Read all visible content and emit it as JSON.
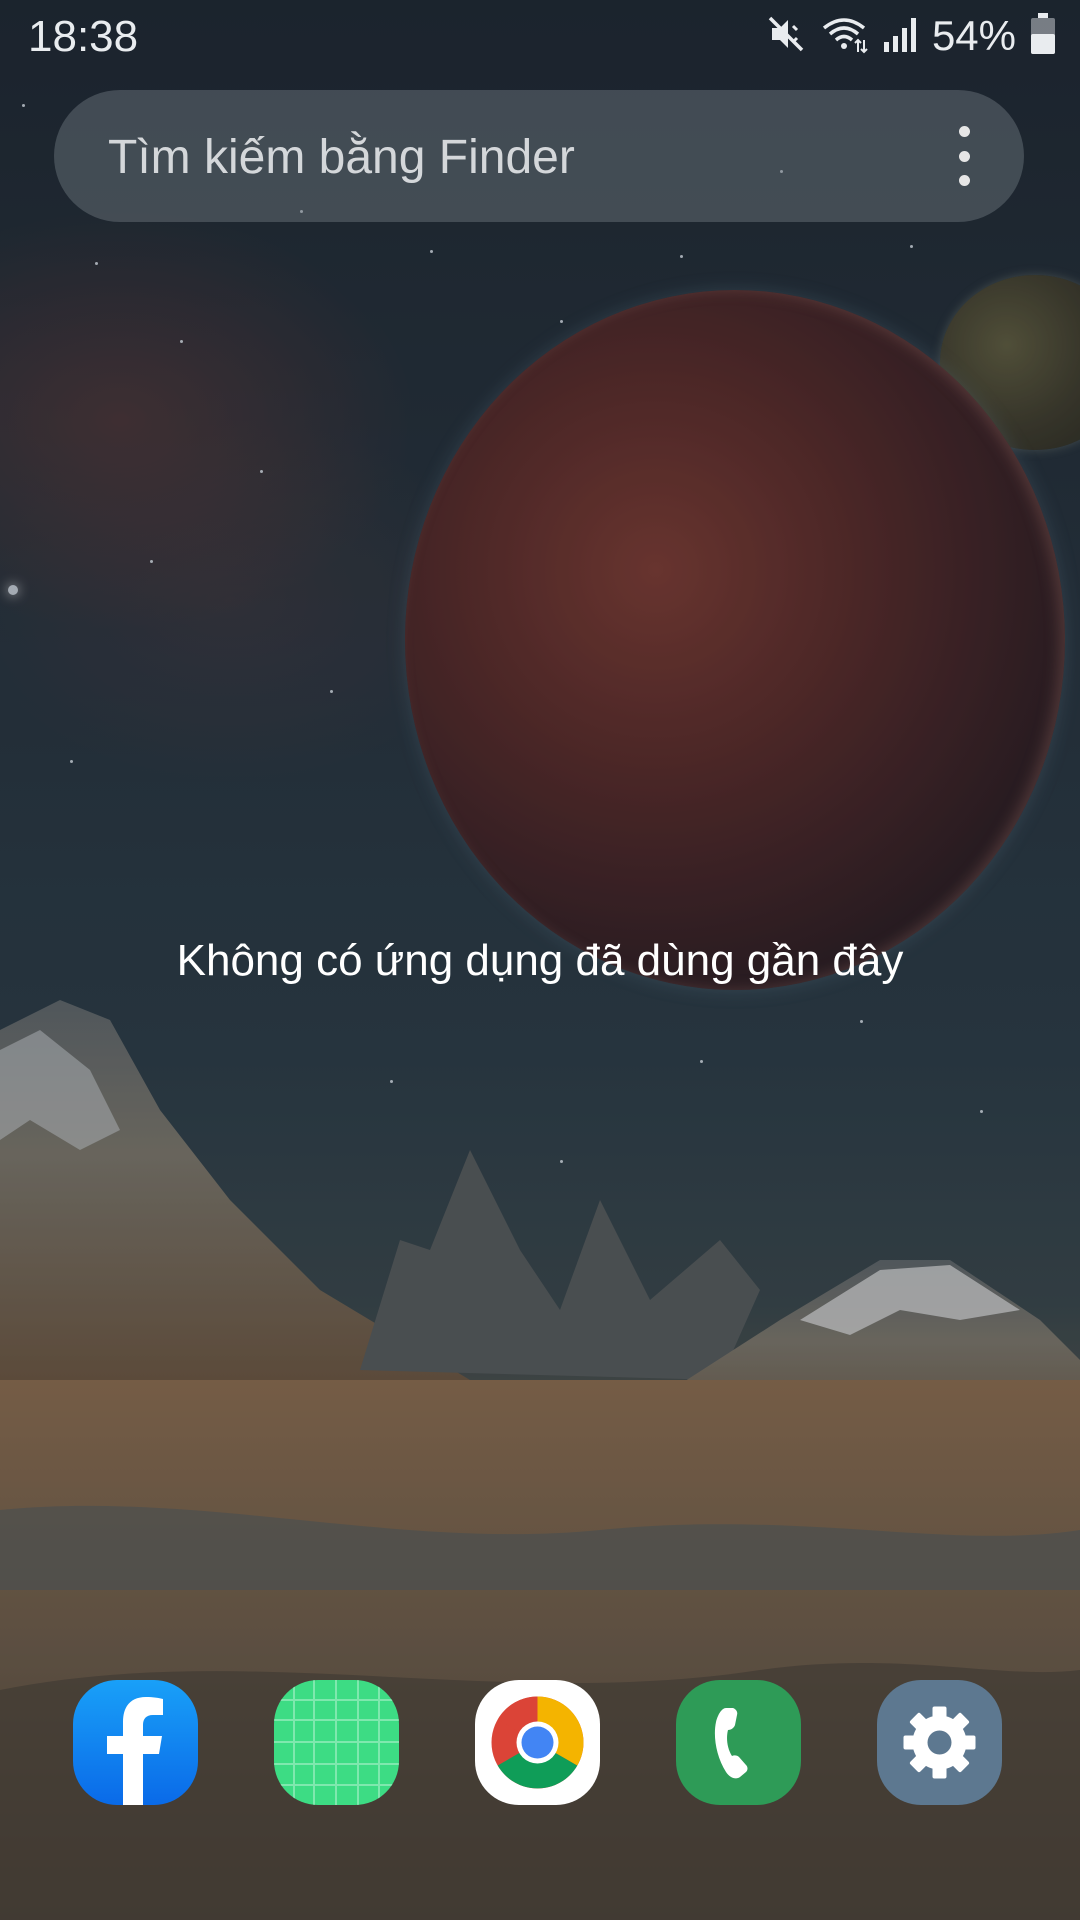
{
  "status_bar": {
    "time": "18:38",
    "battery_percent": "54%",
    "icons": [
      "mute-icon",
      "wifi-icon",
      "signal-icon",
      "battery-icon"
    ]
  },
  "search": {
    "placeholder": "Tìm kiếm bằng Finder",
    "menu_icon": "more-vertical-icon"
  },
  "recents": {
    "empty_message": "Không có ứng dụng đã dùng gần đây"
  },
  "dock": {
    "apps": [
      {
        "icon": "facebook-icon",
        "color": "#1877f2"
      },
      {
        "icon": "grid-app-icon",
        "color": "#3ddc84"
      },
      {
        "icon": "chrome-icon",
        "color": "#ffffff"
      },
      {
        "icon": "phone-icon",
        "color": "#2e9b57"
      },
      {
        "icon": "settings-icon",
        "color": "#5d7890"
      }
    ]
  }
}
